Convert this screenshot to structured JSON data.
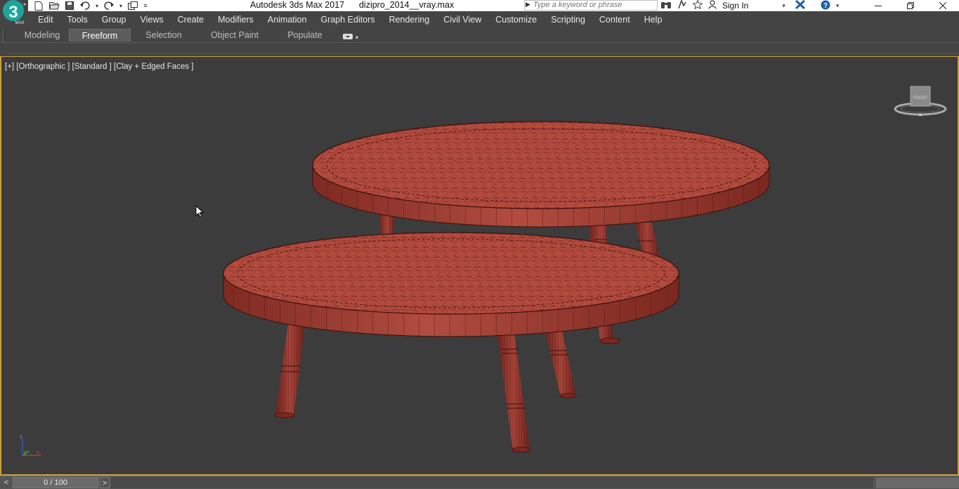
{
  "app": {
    "logo_text": "3",
    "logo_subtext": "MAX",
    "title": "Autodesk 3ds Max 2017",
    "file_name": "dizipro_2014__vray.max"
  },
  "search": {
    "placeholder": "Type a keyword or phrase"
  },
  "account": {
    "signin_label": "Sign In"
  },
  "menu": {
    "items": [
      "Edit",
      "Tools",
      "Group",
      "Views",
      "Create",
      "Modifiers",
      "Animation",
      "Graph Editors",
      "Rendering",
      "Civil View",
      "Customize",
      "Scripting",
      "Content",
      "Help"
    ]
  },
  "ribbon": {
    "tabs": [
      "Modeling",
      "Freeform",
      "Selection",
      "Object Paint",
      "Populate"
    ],
    "active_tab": "Freeform"
  },
  "viewport": {
    "label": "[+] [Orthographic ] [Standard ] [Clay + Edged Faces ]",
    "viewcube_face": "FRONT",
    "axis_labels": [
      "z",
      "y",
      "x"
    ],
    "background_color": "#3c3c3c",
    "active_border_color": "#c8a23c",
    "model_color": "#a8443a"
  },
  "timeline": {
    "slider_value": "0 / 100",
    "prev_label": "<",
    "next_label": ">"
  }
}
